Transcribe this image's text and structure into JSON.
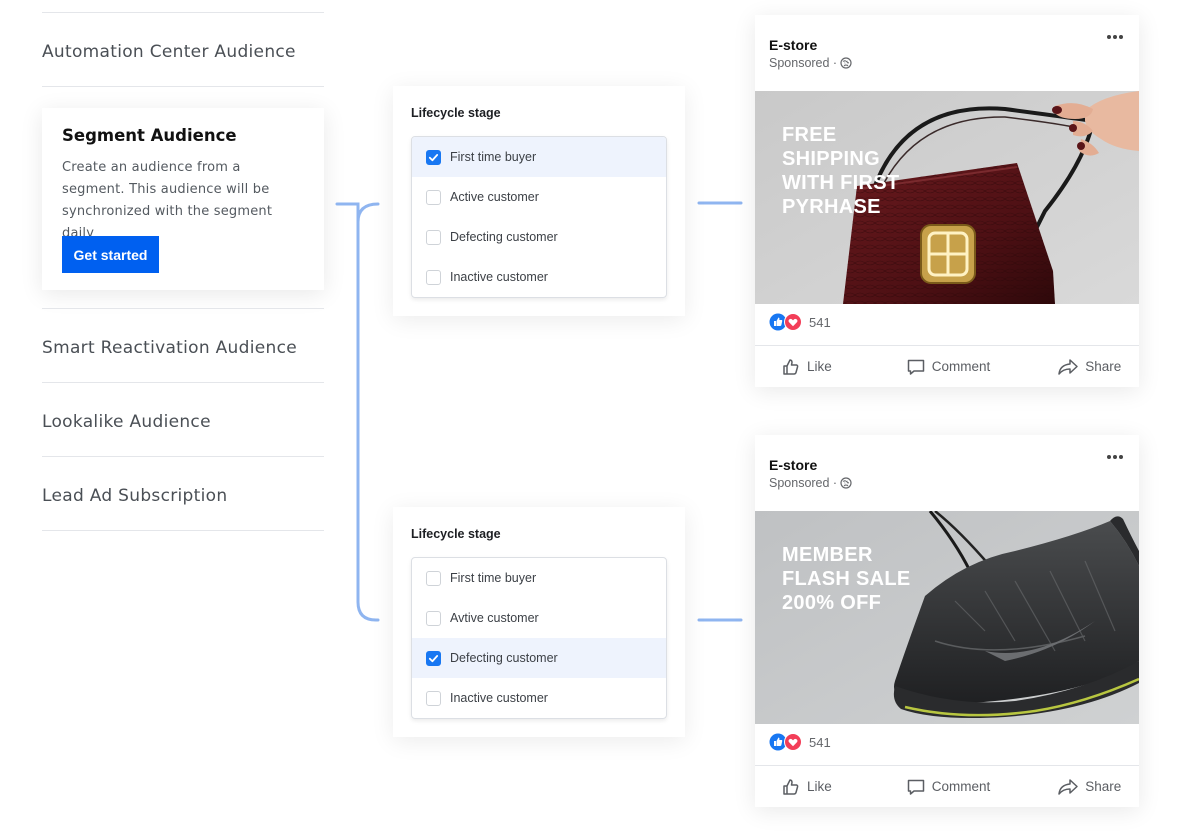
{
  "menu": {
    "items": [
      "Automation Center Audience",
      "Smart Reactivation Audience",
      "Lookalike Audience",
      "Lead Ad Subscription"
    ],
    "segment_card": {
      "title": "Segment Audience",
      "description": "Create an audience from a segment. This audience will be synchronized with the segment daily",
      "cta_label": "Get started"
    }
  },
  "lifecycle_panels": [
    {
      "title": "Lifecycle stage",
      "options": [
        {
          "label": "First time buyer",
          "checked": true
        },
        {
          "label": "Active customer",
          "checked": false
        },
        {
          "label": "Defecting customer",
          "checked": false
        },
        {
          "label": "Inactive customer",
          "checked": false
        }
      ]
    },
    {
      "title": "Lifecycle stage",
      "options": [
        {
          "label": "First time buyer",
          "checked": false
        },
        {
          "label": "Avtive customer",
          "checked": false
        },
        {
          "label": "Defecting customer",
          "checked": true
        },
        {
          "label": "Inactive customer",
          "checked": false
        }
      ]
    }
  ],
  "ads": [
    {
      "brand": "E-store",
      "sponsored": "Sponsored ·",
      "headline": "FREE SHIPPING WITH FIRST PYRHASE",
      "reactions_count": "541",
      "actions": {
        "like": "Like",
        "comment": "Comment",
        "share": "Share"
      }
    },
    {
      "brand": "E-store",
      "sponsored": "Sponsored ·",
      "headline": "MEMBER FLASH SALE 200% OFF",
      "reactions_count": "541",
      "actions": {
        "like": "Like",
        "comment": "Comment",
        "share": "Share"
      }
    }
  ],
  "colors": {
    "primary_button": "#0060f0",
    "connector": "#8fb5f0",
    "checkbox_checked": "#1877f2",
    "like_reaction": "#1877f2",
    "love_reaction": "#f33e58"
  }
}
